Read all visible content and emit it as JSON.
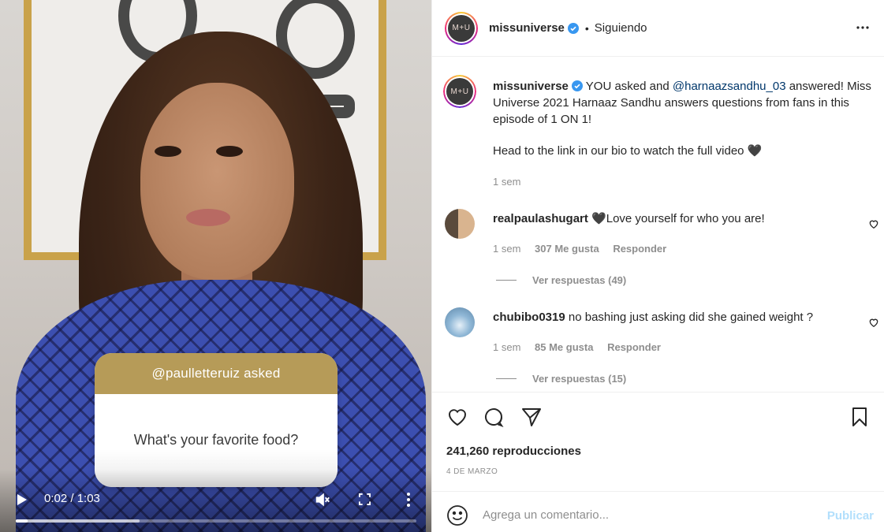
{
  "video": {
    "question_asker": "@paulletteruiz asked",
    "question_text": "What's your favorite food?",
    "time": "0:02 / 1:03",
    "progress": 0.03,
    "buffered": 0.31
  },
  "header": {
    "username": "missuniverse",
    "separator": "•",
    "follow_state": "Siguiendo",
    "avatar_text": "M+U"
  },
  "caption": {
    "username": "missuniverse",
    "text_before": "YOU asked and",
    "mention": "@harnaazsandhu_03",
    "text_after": "answered! Miss Universe 2021 Harnaaz Sandhu answers questions from fans in this episode of 1 ON 1!",
    "line2": "Head to the link in our bio to watch the full video 🖤",
    "time": "1 sem"
  },
  "comments": [
    {
      "username": "realpaulashugart",
      "text": "🖤Love yourself for who you are!",
      "time": "1 sem",
      "likes": "307 Me gusta",
      "reply": "Responder",
      "view_replies": "Ver respuestas (49)"
    },
    {
      "username": "chubibo0319",
      "text": "no bashing just asking did she gained weight ?",
      "time": "1 sem",
      "likes": "85 Me gusta",
      "reply": "Responder",
      "view_replies": "Ver respuestas (15)"
    }
  ],
  "stats": {
    "views": "241,260 reproducciones",
    "date": "4 DE MARZO"
  },
  "add_comment": {
    "placeholder": "Agrega un comentario...",
    "post_label": "Publicar"
  },
  "colors": {
    "verified": "#3897f0",
    "link": "#00376b",
    "muted": "#8e8e8e",
    "post_disabled": "#b2dffc",
    "card_gold": "#b69b58"
  },
  "icons": [
    "play-icon",
    "mute-icon",
    "fullscreen-icon",
    "more-vertical-icon",
    "verified-icon",
    "more-horizontal-icon",
    "heart-icon",
    "comment-icon",
    "share-icon",
    "save-icon",
    "emoji-icon"
  ]
}
